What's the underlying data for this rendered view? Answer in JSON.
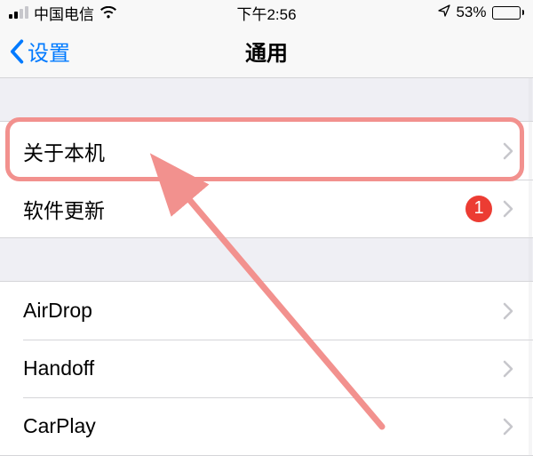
{
  "status": {
    "carrier": "中国电信",
    "time": "下午2:56",
    "battery_pct": "53%"
  },
  "nav": {
    "back_label": "设置",
    "title": "通用"
  },
  "group1": {
    "about_label": "关于本机",
    "update_label": "软件更新",
    "update_badge": "1"
  },
  "group2": {
    "airdrop_label": "AirDrop",
    "handoff_label": "Handoff",
    "carplay_label": "CarPlay"
  }
}
